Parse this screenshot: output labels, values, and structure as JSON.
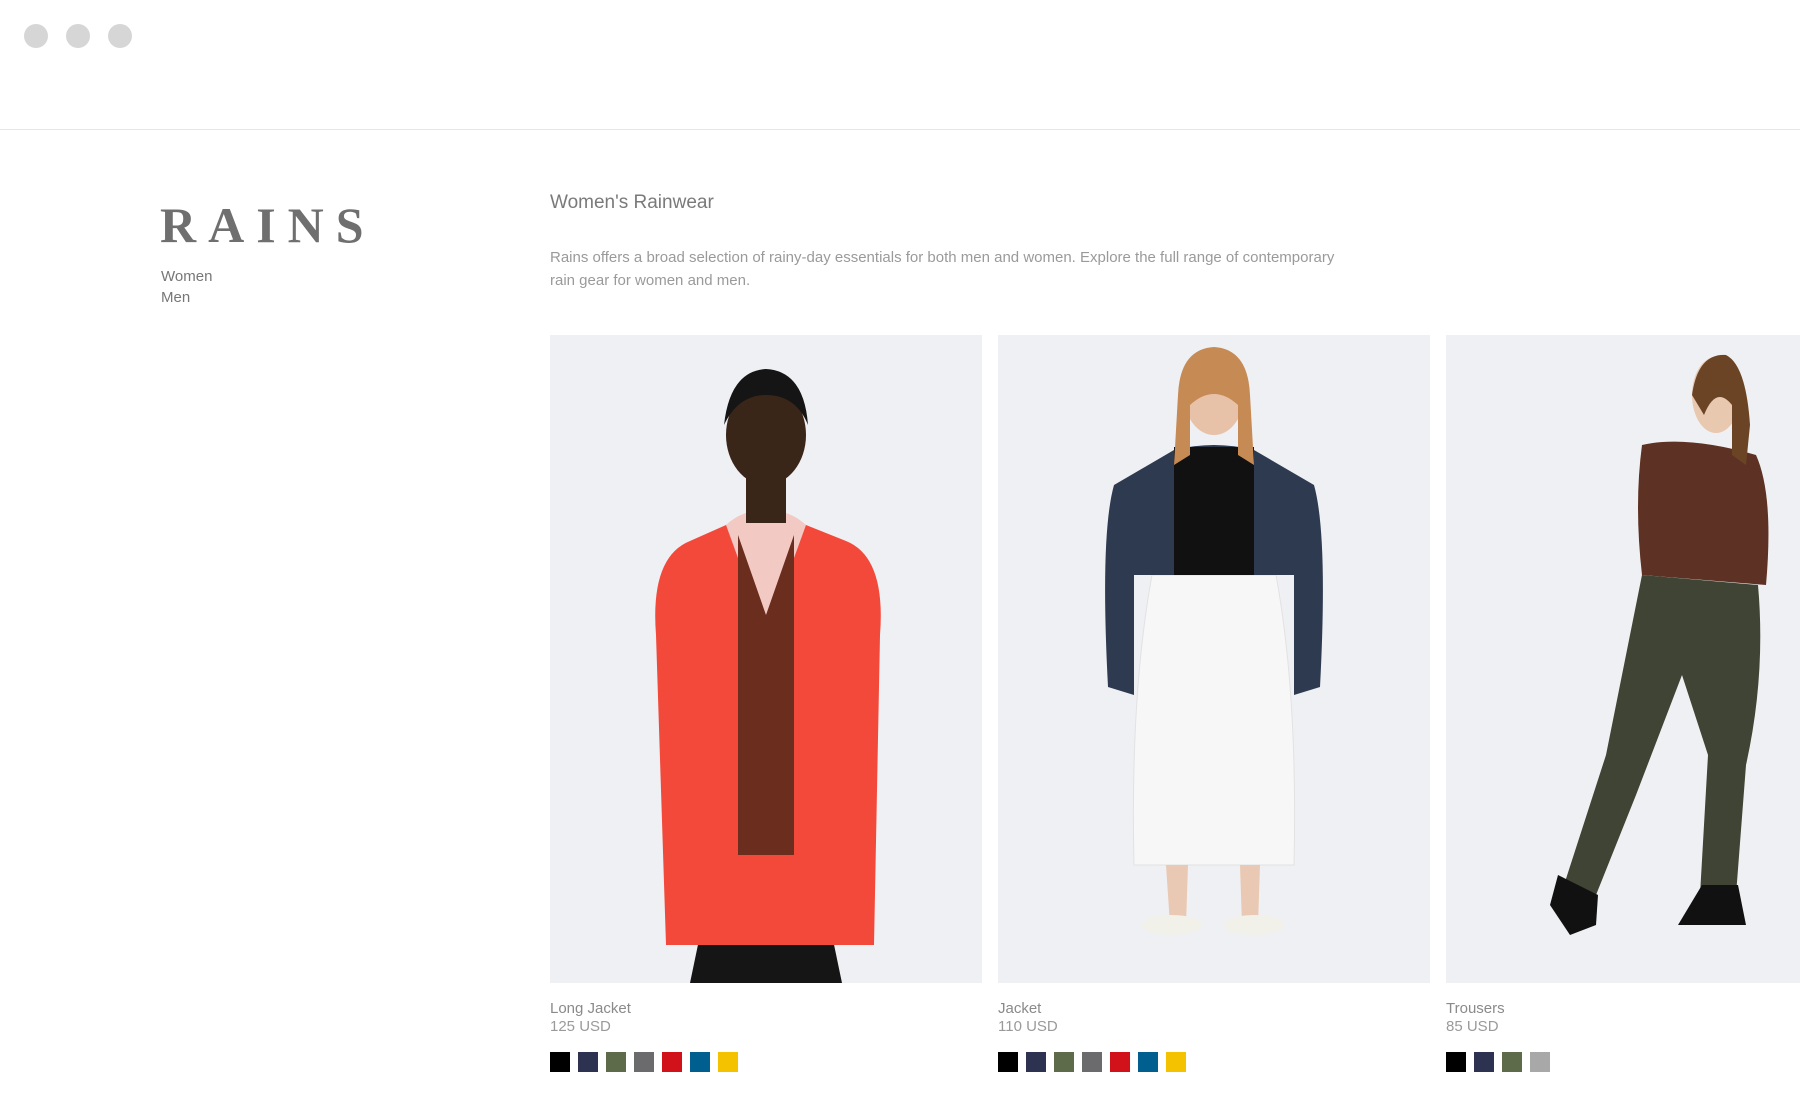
{
  "window": {
    "controls": [
      "close",
      "minimize",
      "maximize"
    ]
  },
  "brand": {
    "logo": "RAINS"
  },
  "nav": {
    "items": [
      {
        "label": "Women"
      },
      {
        "label": "Men"
      }
    ]
  },
  "category": {
    "title": "Women's Rainwear",
    "description": "Rains offers a broad selection of rainy-day essentials for both men and women. Explore the full range of contemporary rain gear for women and men."
  },
  "products": [
    {
      "name": "Long Jacket",
      "price": "125 USD",
      "colors": [
        "#000000",
        "#2d3250",
        "#5e6b4b",
        "#6b6b6d",
        "#d1121b",
        "#005f8f",
        "#f5c200"
      ]
    },
    {
      "name": "Jacket",
      "price": "110 USD",
      "colors": [
        "#000000",
        "#2d3250",
        "#5e6b4b",
        "#6b6b6d",
        "#d1121b",
        "#005f8f",
        "#f5c200"
      ]
    },
    {
      "name": "Trousers",
      "price": "85 USD",
      "colors": [
        "#000000",
        "#2d3250",
        "#5e6b4b",
        "#a8a8a8"
      ]
    }
  ]
}
